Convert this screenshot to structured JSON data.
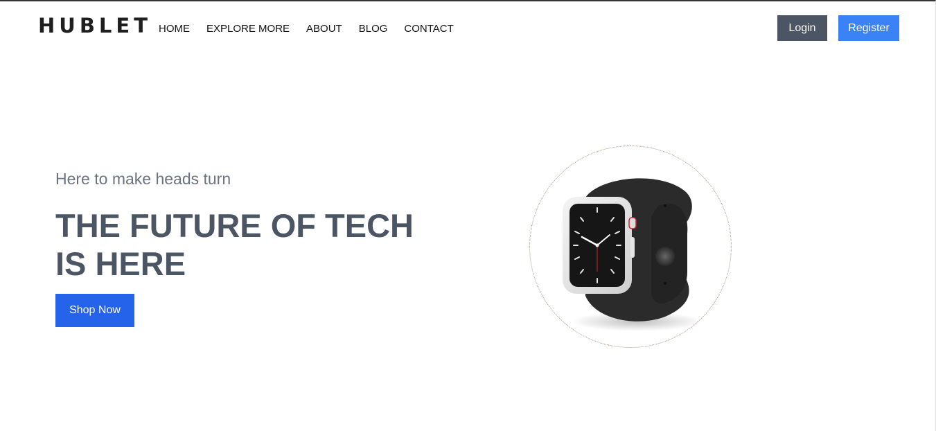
{
  "brand": {
    "logo_text": "HUBLET"
  },
  "nav": {
    "items": [
      {
        "label": "HOME"
      },
      {
        "label": "EXPLORE MORE"
      },
      {
        "label": "ABOUT"
      },
      {
        "label": "BLOG"
      },
      {
        "label": "CONTACT"
      }
    ],
    "login_label": "Login",
    "register_label": "Register"
  },
  "hero": {
    "subtitle": "Here to make heads turn",
    "title_line1": "THE FUTURE OF TECH",
    "title_line2": "IS HERE",
    "cta_label": "Shop Now"
  },
  "colors": {
    "login_bg": "#4b5563",
    "register_bg": "#3b82f6",
    "cta_bg": "#2563eb",
    "heading": "#4b5563",
    "subheading": "#6b7280"
  },
  "product": {
    "icon": "smartwatch-icon"
  }
}
